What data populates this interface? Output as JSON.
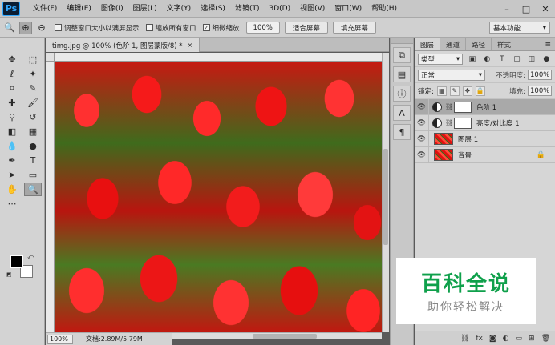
{
  "menubar": {
    "logo": "Ps",
    "items": [
      "文件(F)",
      "编辑(E)",
      "图像(I)",
      "图层(L)",
      "文字(Y)",
      "选择(S)",
      "滤镜(T)",
      "3D(D)",
      "视图(V)",
      "窗口(W)",
      "帮助(H)"
    ],
    "window_controls": [
      "–",
      "□",
      "✕"
    ]
  },
  "options": {
    "opt_resize": "调整窗口大小以满屏显示",
    "opt_zoom_all": "缩放所有窗口",
    "opt_scrubby": "细微缩放",
    "zoom_value": "100%",
    "fit_screen": "适合屏幕",
    "fill_screen": "填充屏幕",
    "workspace": "基本功能"
  },
  "document": {
    "tab_title": "timg.jpg @ 100% (色阶 1, 图层蒙版/8) *",
    "close": "×",
    "zoom": "100%",
    "doc_size": "文档:2.89M/5.79M"
  },
  "layers_panel": {
    "tabs": [
      "图层",
      "通道",
      "路径",
      "样式"
    ],
    "menu": "≡",
    "filter_kind": "类型",
    "blend_mode": "正常",
    "opacity_label": "不透明度:",
    "opacity_value": "100%",
    "lock_label": "锁定:",
    "fill_label": "填充:",
    "fill_value": "100%",
    "layers": [
      {
        "name": "色阶 1"
      },
      {
        "name": "亮度/对比度 1"
      },
      {
        "name": "图层 1"
      },
      {
        "name": "背景"
      }
    ]
  },
  "watermark": {
    "title": "百科全说",
    "subtitle": "助你轻松解决"
  },
  "colors": {
    "foreground": "#000000",
    "background": "#ffffff",
    "watermark_green": "#0fa04b"
  }
}
